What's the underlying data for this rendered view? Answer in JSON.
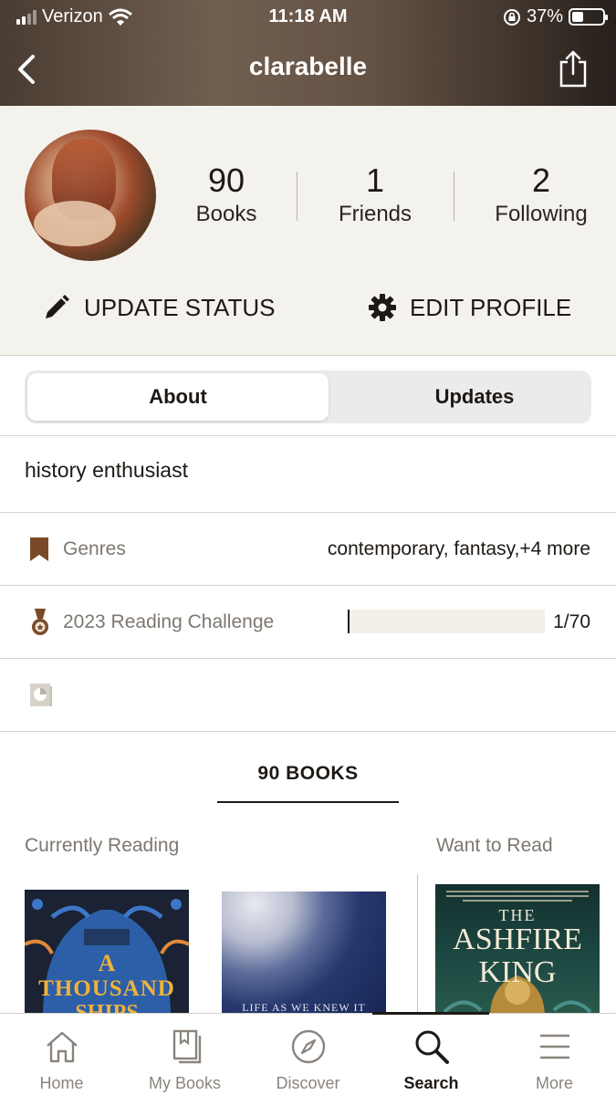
{
  "status_bar": {
    "carrier": "Verizon",
    "time": "11:18 AM",
    "battery": "37%"
  },
  "nav": {
    "title": "clarabelle",
    "back_icon": "chevron-left-icon",
    "share_icon": "share-icon"
  },
  "profile": {
    "stats": [
      {
        "value": "90",
        "label": "Books"
      },
      {
        "value": "1",
        "label": "Friends"
      },
      {
        "value": "2",
        "label": "Following"
      }
    ],
    "update_status_label": "UPDATE STATUS",
    "edit_profile_label": "EDIT PROFILE"
  },
  "tabs": {
    "about": "About",
    "updates": "Updates",
    "active": "About"
  },
  "about": {
    "bio": "history enthusiast",
    "genres_label": "Genres",
    "genres_value": "contemporary, fantasy,+4 more",
    "challenge_label": "2023 Reading Challenge",
    "challenge_value": "1/70",
    "challenge_progress": 0.0143
  },
  "books": {
    "count_label": "90 BOOKS",
    "currently_reading_label": "Currently Reading",
    "want_to_read_label": "Want to Read",
    "covers": [
      {
        "line1": "A",
        "line2": "THOUSAND",
        "line3": "SHIPS"
      },
      {
        "line1": "LIFE AS WE KNEW IT"
      },
      {
        "line1": "THE",
        "line2": "ASHFIRE",
        "line3": "KING"
      }
    ]
  },
  "bottom_nav": [
    {
      "label": "Home",
      "icon": "home-icon"
    },
    {
      "label": "My Books",
      "icon": "my-books-icon"
    },
    {
      "label": "Discover",
      "icon": "compass-icon"
    },
    {
      "label": "Search",
      "icon": "search-icon",
      "active": true
    },
    {
      "label": "More",
      "icon": "menu-icon"
    }
  ],
  "colors": {
    "text": "#1e1915",
    "muted": "#7d7770",
    "profile_bg": "#f4f2ed",
    "bookmark": "#7a4a28"
  }
}
